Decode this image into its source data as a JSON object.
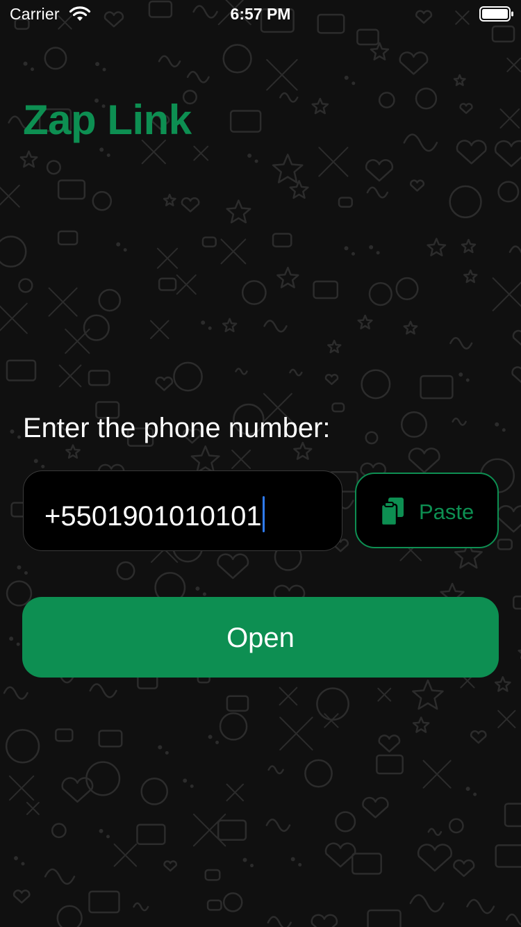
{
  "status_bar": {
    "carrier": "Carrier",
    "time": "6:57 PM",
    "wifi_icon": "wifi-icon",
    "battery_icon": "battery-full-icon"
  },
  "app": {
    "title": "Zap Link",
    "accent_color": "#0d8f52"
  },
  "form": {
    "prompt": "Enter the phone number:",
    "phone_value": "+5501901010101",
    "paste_label": "Paste",
    "paste_icon": "clipboard-icon",
    "open_label": "Open"
  }
}
